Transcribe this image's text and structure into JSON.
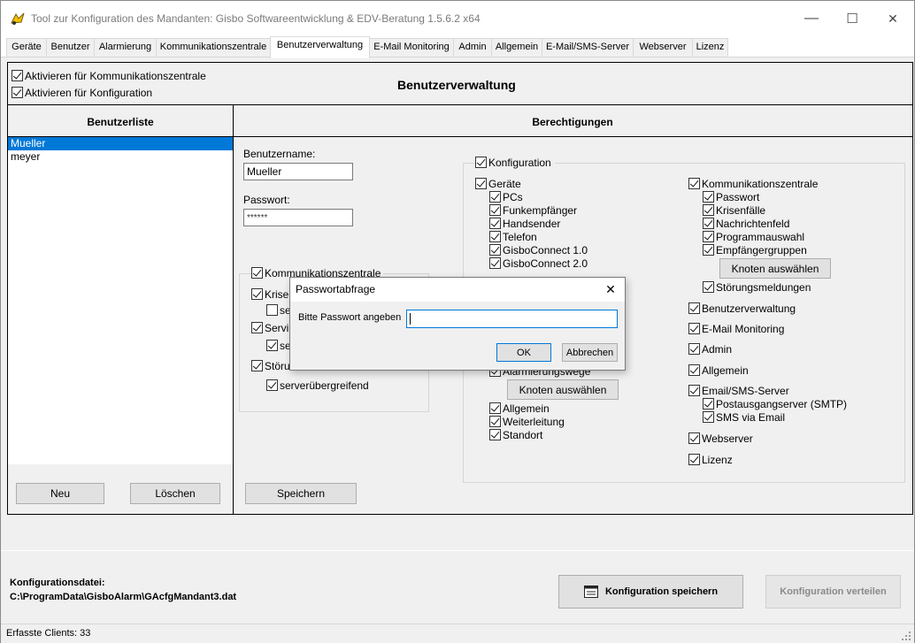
{
  "window": {
    "title": "Tool zur Konfiguration des Mandanten: Gisbo Softwareentwicklung & EDV-Beratung 1.5.6.2 x64",
    "minimize_glyph": "—",
    "maximize_glyph": "☐",
    "close_glyph": "✕"
  },
  "tabs": [
    {
      "label": "Geräte"
    },
    {
      "label": "Benutzer"
    },
    {
      "label": "Alarmierung"
    },
    {
      "label": "Kommunikationszentrale"
    },
    {
      "label": "Benutzerverwaltung",
      "active": true
    },
    {
      "label": "E-Mail Monitoring"
    },
    {
      "label": "Admin"
    },
    {
      "label": "Allgemein"
    },
    {
      "label": "E-Mail/SMS-Server"
    },
    {
      "label": "Webserver"
    },
    {
      "label": "Lizenz"
    }
  ],
  "header": {
    "activate_kz": "Aktivieren für Kommunikationszentrale",
    "activate_config": "Aktivieren für Konfiguration",
    "title": "Benutzerverwaltung"
  },
  "userlist": {
    "title": "Benutzerliste",
    "users": [
      "Mueller",
      "meyer"
    ],
    "selected": "Mueller",
    "new_button": "Neu",
    "delete_button": "Löschen"
  },
  "permissions": {
    "title": "Berechtigungen",
    "username_label": "Benutzername:",
    "username_value": "Mueller",
    "password_label": "Passwort:",
    "password_value": "******",
    "save_button": "Speichern",
    "kz_group": {
      "title": "Kommunikationszentrale",
      "items": [
        "Krisenfälle",
        "serverübergreifend",
        "Servicemeldungen",
        "serverübergreifend",
        "Störungsmeldungen",
        "serverübergreifend"
      ],
      "visible": [
        "Krise",
        "se",
        "Servi",
        "se",
        "Störu",
        "serverübergreifend"
      ]
    },
    "konfiguration": "Konfiguration",
    "geraete": "Geräte",
    "geraete_items": [
      "PCs",
      "Funkempfänger",
      "Handsender",
      "Telefon",
      "GisboConnect 1.0",
      "GisboConnect 2.0"
    ],
    "alarmierungswege": "Alarmierungswege",
    "knoten_button": "Knoten auswählen",
    "alarm_items": [
      "Allgemein",
      "Weiterleitung",
      "Standort"
    ],
    "right_kz": "Kommunikationszentrale",
    "right_kz_items": [
      "Passwort",
      "Krisenfälle",
      "Nachrichtenfeld",
      "Programmauswahl",
      "Empfängergruppen"
    ],
    "right_knoten_button": "Knoten auswählen",
    "stoerungsmeldungen": "Störungsmeldungen",
    "benutzerverwaltung": "Benutzerverwaltung",
    "email_monitoring": "E-Mail Monitoring",
    "admin": "Admin",
    "allgemein": "Allgemein",
    "email_sms_server": "Email/SMS-Server",
    "email_sms_items": [
      "Postausgangserver (SMTP)",
      "SMS via Email"
    ],
    "webserver": "Webserver",
    "lizenz": "Lizenz"
  },
  "dialog": {
    "title": "Passwortabfrage",
    "prompt": "Bitte Passwort angeben",
    "input_value": "",
    "ok": "OK",
    "cancel": "Abbrechen"
  },
  "footer": {
    "config_file_label": "Konfigurationsdatei:",
    "config_file_path": "C:\\ProgramData\\GisboAlarm\\GAcfgMandant3.dat",
    "save_config_button": "Konfiguration speichern",
    "distribute_config_button": "Konfiguration verteilen",
    "status": "Erfasste Clients: 33"
  }
}
